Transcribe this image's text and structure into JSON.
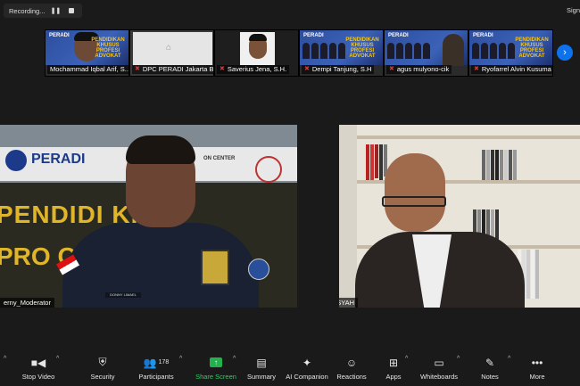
{
  "recording": {
    "label": "Recording...",
    "pause_icon": "❚❚",
    "stop_icon": "stop"
  },
  "top_right": {
    "text": "Sign"
  },
  "thumbnails": [
    {
      "name": "Mochammad Iqbal Arif, S..."
    },
    {
      "name": "DPC PERADI Jakarta B..."
    },
    {
      "name": "Saverius Jena, S.H."
    },
    {
      "name": "Dempi Tanjung, S.H"
    },
    {
      "name": "agus mulyono-cik"
    },
    {
      "name": "Ryofarrel Alvin Kusuma"
    }
  ],
  "banner": {
    "logo": "PERADI",
    "lines": "PENDIDIKAN KHUSUS PROFESI ADVOKAT"
  },
  "main_left": {
    "name": "erny_Moderator",
    "banner_word": "PERADI",
    "big_text_1": "PENDIDI   KHUS",
    "big_text_2": "PRO          O",
    "center_text": "ON CENTER",
    "nameplate": "DONNY LIMAEL"
  },
  "main_right": {
    "name": "ARDIANSYAH"
  },
  "toolbar": {
    "items": [
      {
        "label": "Stop Video",
        "icon": "video-camera-icon"
      },
      {
        "label": "Security",
        "icon": "shield-icon"
      },
      {
        "label": "Participants",
        "icon": "people-icon",
        "count": "178"
      },
      {
        "label": "Share Screen",
        "icon": "share-screen-icon"
      },
      {
        "label": "Summary",
        "icon": "summary-icon"
      },
      {
        "label": "AI Companion",
        "icon": "sparkle-icon"
      },
      {
        "label": "Reactions",
        "icon": "smiley-plus-icon"
      },
      {
        "label": "Apps",
        "icon": "apps-icon"
      },
      {
        "label": "Whiteboards",
        "icon": "whiteboard-icon"
      },
      {
        "label": "Notes",
        "icon": "notes-icon"
      },
      {
        "label": "More",
        "icon": "more-icon"
      }
    ]
  },
  "colors": {
    "accent": "#0e72ed",
    "share_green": "#23b14d",
    "mute_red": "#e0302e",
    "background": "#1a1a1a"
  }
}
